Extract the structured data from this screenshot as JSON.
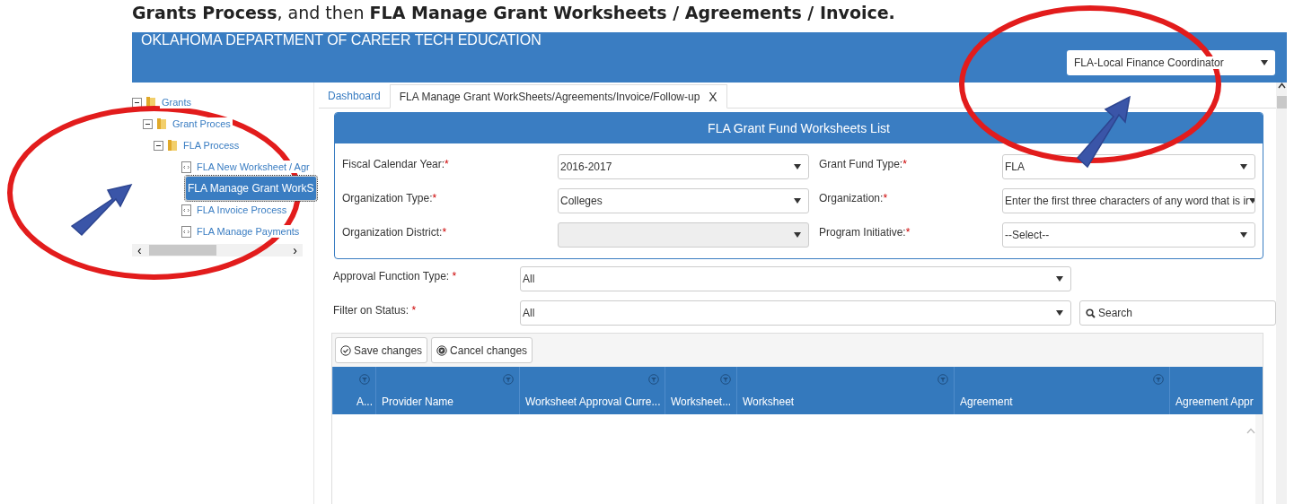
{
  "caption": "**Grants Process**, and then **FLA Manage Grant Worksheets / Agreements / Invoice.**",
  "header": {
    "title": "OKLAHOMA DEPARTMENT OF CAREER TECH EDUCATION",
    "role": "FLA-Local Finance Coordinator"
  },
  "tree": [
    {
      "label": "Grants",
      "kind": "folder",
      "expanded": true,
      "selected": false,
      "children": [
        {
          "label": "Grant Proces",
          "kind": "folder",
          "expanded": true,
          "selected": false,
          "children": [
            {
              "label": "FLA Process",
              "kind": "folder",
              "expanded": true,
              "selected": false,
              "children": [
                {
                  "label": "FLA New Worksheet / Agr",
                  "kind": "page",
                  "selected": false
                },
                {
                  "label": "FLA Manage Grant WorkS",
                  "kind": "page",
                  "selected": true
                },
                {
                  "label": "FLA Invoice Process",
                  "kind": "page",
                  "selected": false
                },
                {
                  "label": "FLA Manage Payments",
                  "kind": "page",
                  "selected": false
                }
              ]
            }
          ]
        }
      ]
    }
  ],
  "tree_scroll": {
    "left": "‹",
    "right": "›"
  },
  "tabs": [
    {
      "label": "Dashboard",
      "selected": false,
      "closable": false
    },
    {
      "label": "FLA Manage Grant WorkSheets/Agreements/Invoice/Follow-up",
      "selected": true,
      "closable": true,
      "close": "X"
    }
  ],
  "form": {
    "title": "FLA Grant Fund Worksheets List",
    "fields": [
      {
        "label": "Fiscal Calendar Year:",
        "required": "*",
        "value": "2016-2017",
        "disabled": false
      },
      {
        "label": "Grant Fund Type:",
        "required": "*",
        "value": "FLA",
        "disabled": false
      },
      {
        "label": "Organization Type:",
        "required": "*",
        "value": "Colleges",
        "disabled": false
      },
      {
        "label": "Organization:",
        "required": "*",
        "value": "Enter the first three characters of any word that is ir",
        "disabled": false
      },
      {
        "label": "Organization District:",
        "required": "*",
        "disabled": true
      },
      {
        "label": "Program Initiative:",
        "required": "*",
        "value": "--Select--",
        "disabled": false
      }
    ]
  },
  "filters": [
    {
      "label": "Approval Function Type: ",
      "required": "*",
      "value": "All"
    },
    {
      "label": "Filter on Status: ",
      "required": "*",
      "value": "All"
    }
  ],
  "search_button": "Search",
  "toolbar": [
    {
      "label": "Save changes",
      "kind": "save"
    },
    {
      "label": "Cancel changes",
      "kind": "cancel"
    }
  ],
  "columns": [
    {
      "label": "A...",
      "filter": true
    },
    {
      "label": "Provider Name",
      "filter": true
    },
    {
      "label": "Worksheet Approval Curre...",
      "filter": true
    },
    {
      "label": "Worksheet...",
      "filter": true
    },
    {
      "label": "Worksheet",
      "filter": true
    },
    {
      "label": "Agreement",
      "filter": true
    },
    {
      "label": "Agreement Appr",
      "filter": false
    }
  ],
  "annotations": [
    {
      "kind": "ellipse"
    },
    {
      "kind": "ellipse"
    },
    {
      "kind": "arrow"
    },
    {
      "kind": "arrow"
    }
  ]
}
